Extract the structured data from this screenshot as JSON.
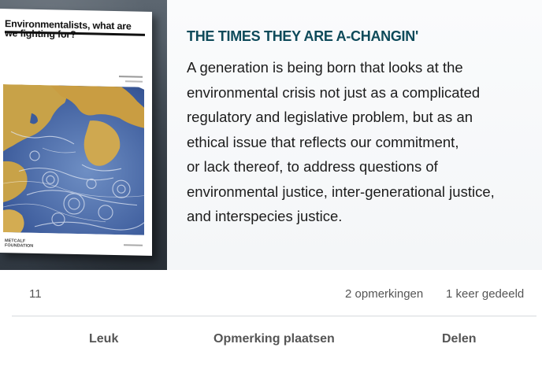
{
  "post": {
    "image": {
      "cover": {
        "title": "Environmentalists, what are we fighting for?",
        "logo_text": "METCALF FOUNDATION"
      },
      "headline": "THE TIMES THEY ARE A-CHANGIN'",
      "body": "A generation is being born that looks at the\nenvironmental crisis not just as a complicated\nregulatory and legislative problem, but as an\nethical issue that reflects our commitment,\nor lack thereof, to address questions of\nenvironmental justice, inter-generational justice,\nand interspecies justice.",
      "colors": {
        "headline": "#0e4a5a",
        "ocean": "#2c4a8a",
        "land": "#c8a248"
      }
    },
    "counts": {
      "reactions": "11",
      "comments": "2 opmerkingen",
      "shares": "1 keer gedeeld"
    },
    "actions": {
      "like": "Leuk",
      "comment": "Opmerking plaatsen",
      "share": "Delen"
    }
  }
}
